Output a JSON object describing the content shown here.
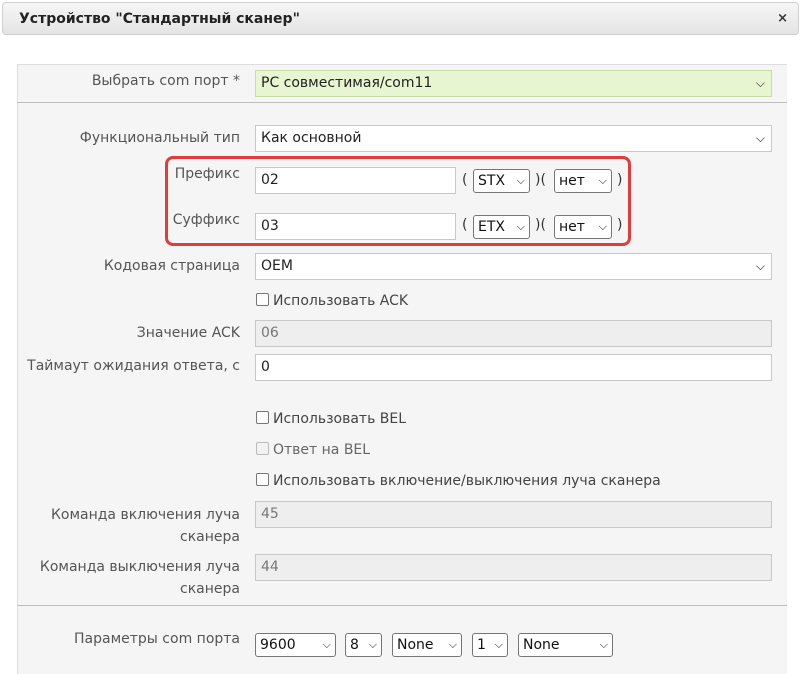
{
  "window": {
    "title": "Устройство \"Стандартный сканер\"",
    "close_icon": "close-icon",
    "close_glyph": "×"
  },
  "fields": {
    "com_port": {
      "label": "Выбрать com порт *",
      "value": "PC совместимая/com11"
    },
    "func_type": {
      "label": "Функциональный тип",
      "value": "Как основной"
    },
    "prefix": {
      "label": "Префикс",
      "value": "02",
      "code": "STX",
      "extra": "нет"
    },
    "suffix": {
      "label": "Суффикс",
      "value": "03",
      "code": "ETX",
      "extra": "нет"
    },
    "codepage": {
      "label": "Кодовая страница",
      "value": "OEM"
    },
    "use_ack": {
      "label": "Использовать ACK",
      "checked": false
    },
    "ack_value": {
      "label": "Значение ACK",
      "value": "06"
    },
    "timeout": {
      "label": "Таймаут ожидания ответа, с",
      "value": "0"
    },
    "use_bel": {
      "label": "Использовать BEL",
      "checked": false
    },
    "bel_reply": {
      "label": "Ответ на BEL",
      "checked": false,
      "disabled": true
    },
    "use_beam": {
      "label": "Использовать включение/выключения луча сканера",
      "checked": false
    },
    "beam_on": {
      "label": "Команда включения луча сканера",
      "value": "45"
    },
    "beam_off": {
      "label": "Команда выключения луча сканера",
      "value": "44"
    },
    "com_params": {
      "label": "Параметры com порта",
      "baud": "9600",
      "bits": "8",
      "parity": "None",
      "stop": "1",
      "flow": "None"
    }
  },
  "punct": {
    "open": "(",
    "mid": ")(",
    "close": ")"
  },
  "arrow": "⌄",
  "highlight_color": "#e03c3c"
}
